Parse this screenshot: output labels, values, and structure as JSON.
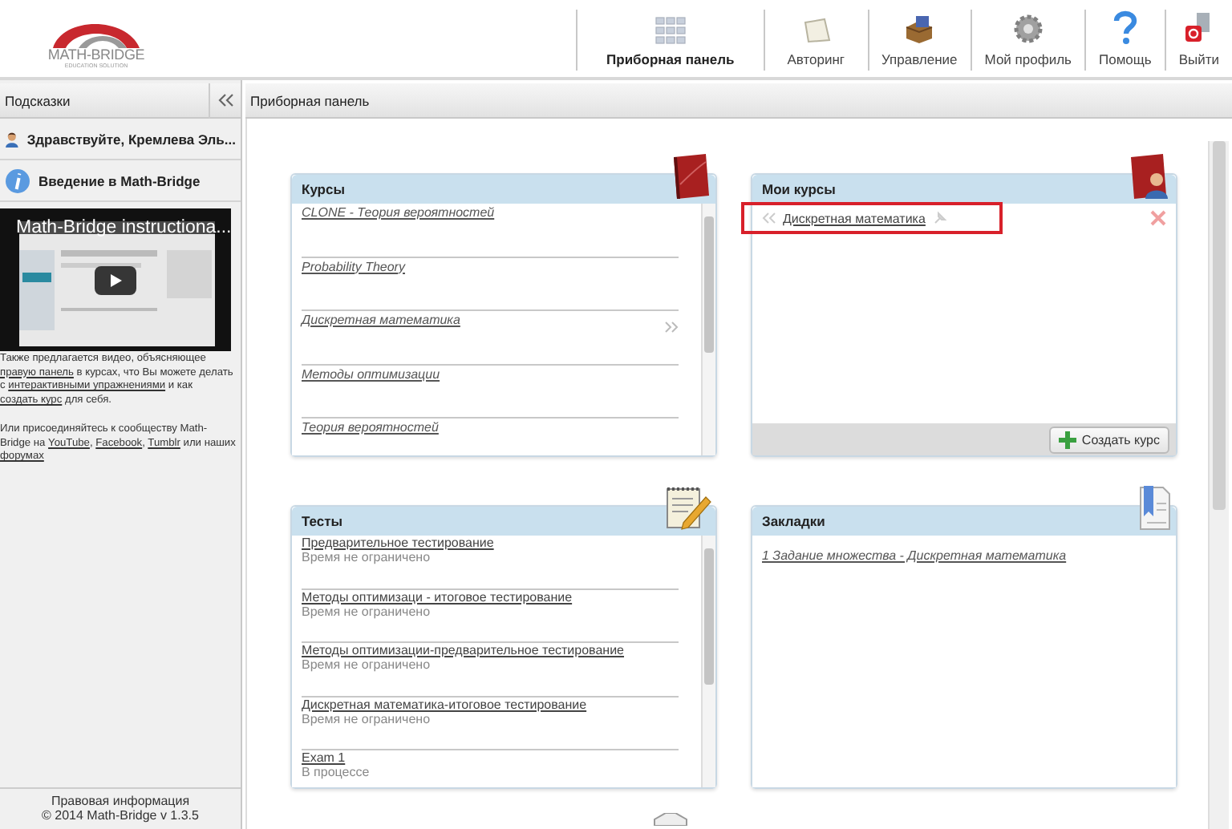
{
  "logo": {
    "name": "MATH-BRIDGE",
    "tagline": "EDUCATION SOLUTION"
  },
  "nav": [
    {
      "label": "Приборная панель",
      "selected": true
    },
    {
      "label": "Авторинг",
      "selected": false
    },
    {
      "label": "Управление",
      "selected": false
    },
    {
      "label": "Мой профиль",
      "selected": false
    },
    {
      "label": "Помощь",
      "selected": false
    },
    {
      "label": "Выйти",
      "selected": false
    }
  ],
  "sidebar": {
    "title": "Подсказки",
    "greeting": "Здравствуйте, Кремлева Эль...",
    "intro_title": "Введение в Math-Bridge",
    "video_title": "Math-Bridge instructiona...",
    "paragraphs": [
      [
        {
          "text": "Также предлагается видео, объясняющее ",
          "link": false
        },
        {
          "text": "правую панель",
          "link": true
        },
        {
          "text": " в курсах, что Вы можете делать с ",
          "link": false
        },
        {
          "text": "интерактивными упражнениями",
          "link": true
        },
        {
          "text": " и как ",
          "link": false
        },
        {
          "text": "создать курс",
          "link": true
        },
        {
          "text": " для себя.",
          "link": false
        }
      ],
      [
        {
          "text": "Или присоединяйтесь к сообществу Math-Bridge на ",
          "link": false
        },
        {
          "text": "YouTube",
          "link": true
        },
        {
          "text": ", ",
          "link": false
        },
        {
          "text": "Facebook",
          "link": true
        },
        {
          "text": ", ",
          "link": false
        },
        {
          "text": "Tumblr",
          "link": true
        },
        {
          "text": " или наших ",
          "link": false
        },
        {
          "text": "форумах",
          "link": true
        }
      ]
    ],
    "footer": [
      "Правовая информация",
      "© 2014 Math-Bridge v 1.3.5"
    ]
  },
  "main": {
    "title": "Приборная панель",
    "cards": [
      {
        "kind": "courses",
        "title": "Курсы",
        "items": [
          {
            "title": "CLONE - Теория вероятностей",
            "hovered": false
          },
          {
            "title": "Probability Theory",
            "hovered": false
          },
          {
            "title": "Дискретная математика",
            "hovered": true
          },
          {
            "title": "Методы оптимизации",
            "hovered": false
          },
          {
            "title": "Теория вероятностей",
            "hovered": false
          }
        ]
      },
      {
        "kind": "my_courses",
        "title": "Мои курсы",
        "items": [
          {
            "title": "Дискретная математика",
            "highlighted": true
          }
        ],
        "button": "Создать курс"
      },
      {
        "kind": "tests",
        "title": "Тесты",
        "items": [
          {
            "title": "Предварительное тестирование",
            "status": "Время не ограничено"
          },
          {
            "title": "Методы оптимизаци - итоговое тестирование",
            "status": "Время не ограничено"
          },
          {
            "title": "Методы оптимизации-предварительное тестирование",
            "status": "Время не ограничено"
          },
          {
            "title": "Дискретная математика-итоговое тестирование",
            "status": "Время не ограничено"
          },
          {
            "title": "Exam 1",
            "status": "В процессе"
          }
        ]
      },
      {
        "kind": "bookmarks",
        "title": "Закладки",
        "items": [
          {
            "title": "1 Задание множества - Дискретная математика"
          }
        ]
      }
    ]
  }
}
